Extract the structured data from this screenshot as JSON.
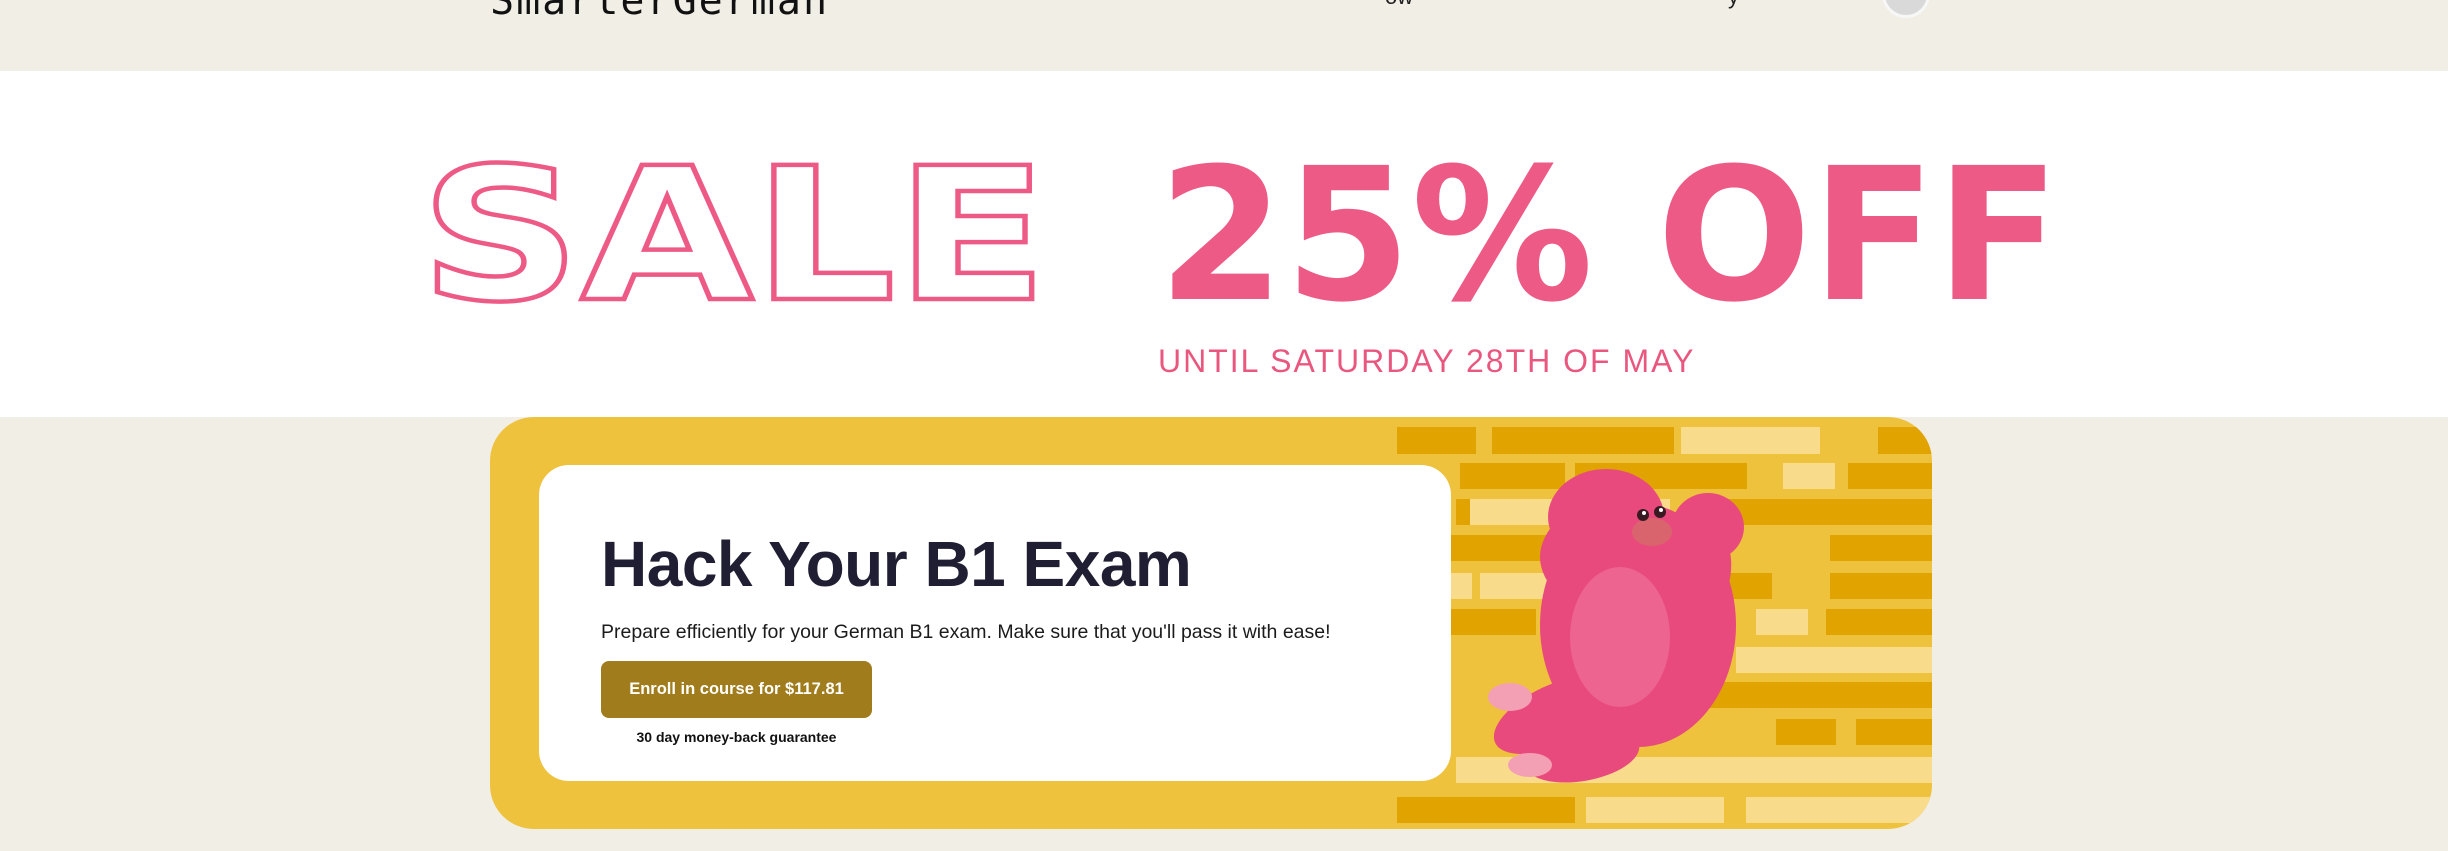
{
  "header": {
    "logo_text": "SmarterGerman",
    "nav_fragment_1": "ow",
    "nav_fragment_2": "y"
  },
  "sale": {
    "word": "SALE",
    "discount": "25% OFF",
    "until": "UNTIL SATURDAY 28TH OF MAY",
    "color": "#ee5a86"
  },
  "course": {
    "title": "Hack Your B1 Exam",
    "description": "Prepare efficiently for your German B1 exam. Make sure that you'll pass it with ease!",
    "enroll_label": "Enroll in course for $117.81",
    "guarantee": "30 day money-back guarantee",
    "accent": "#efc23d",
    "button_color": "#a07c1d"
  }
}
